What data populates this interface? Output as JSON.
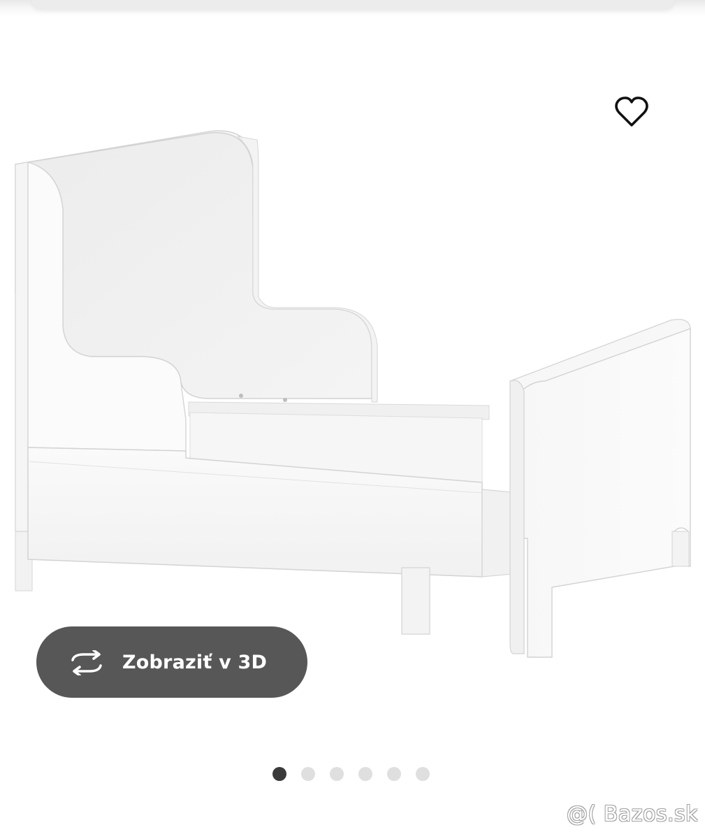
{
  "product": {
    "image_description_icon": "extendable-childrens-bed-image",
    "favorite_icon": "heart-outline-icon"
  },
  "viewer": {
    "view_3d_label": "Zobraziť v 3D",
    "view_3d_icon": "rotate-arrows-icon"
  },
  "carousel": {
    "total": 6,
    "active_index": 0
  },
  "watermark": {
    "text": "@( Bazos.sk"
  },
  "colors": {
    "button_bg": "#575757",
    "dot_active": "#3a3a3a",
    "dot_inactive": "#dfdfdf"
  }
}
